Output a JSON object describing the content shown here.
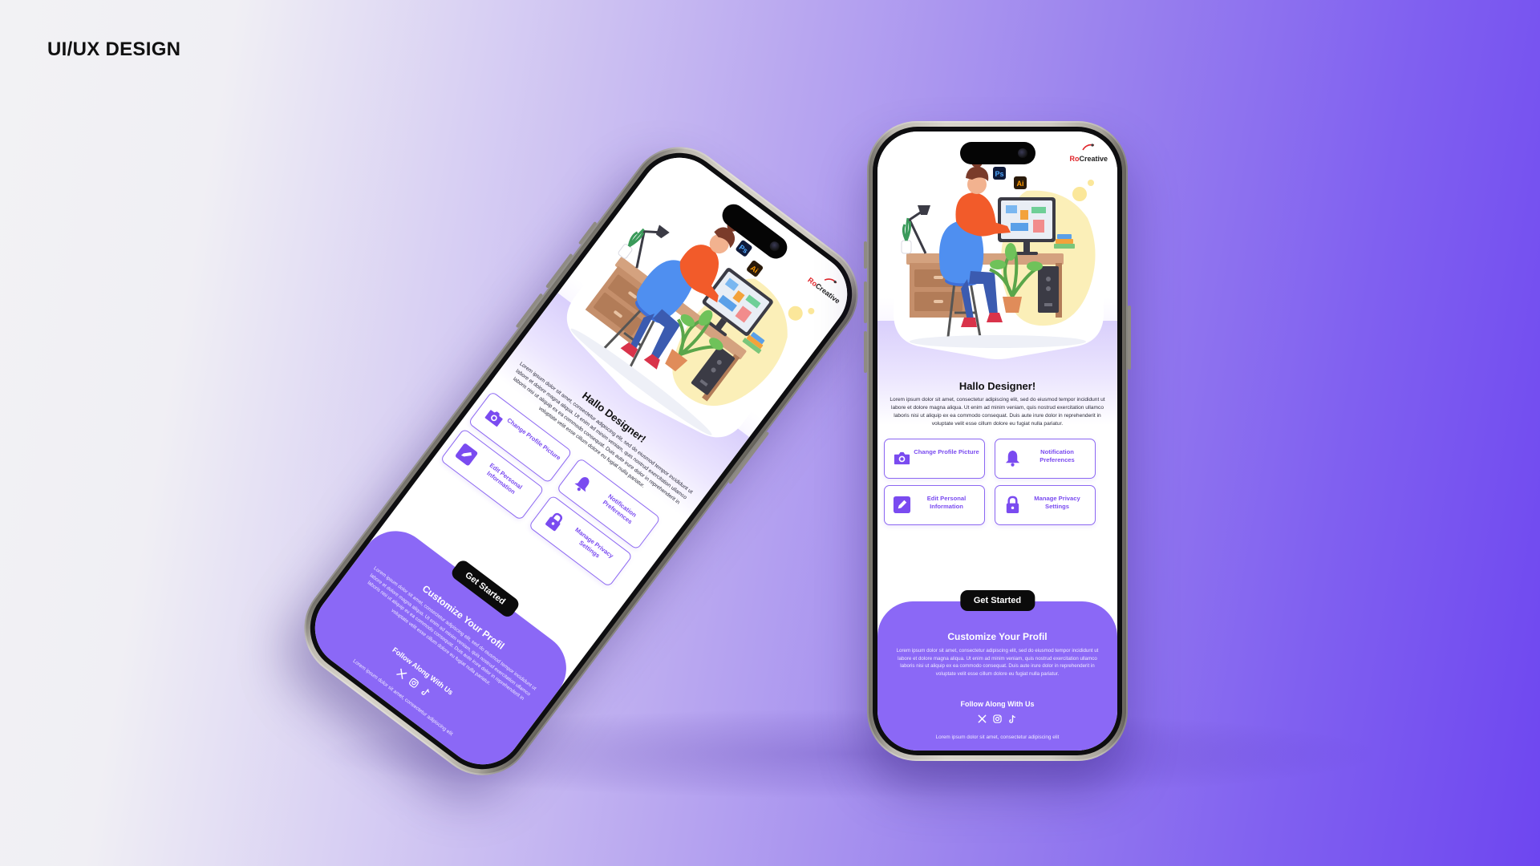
{
  "page": {
    "title": "UI/UX DESIGN"
  },
  "app": {
    "logo": {
      "prefix": "Ro",
      "suffix": "Creative"
    },
    "hero": {
      "software_badges": [
        "Ps",
        "Ai"
      ]
    },
    "greeting": "Hallo Designer!",
    "intro": "Lorem ipsum dolor sit amet, consectetur adipiscing elit, sed do eiusmod tempor incididunt ut labore et dolore magna aliqua. Ut enim ad minim veniam, quis nostrud exercitation ullamco laboris nisi ut aliquip ex ea commodo consequat. Duis aute irure dolor in reprehenderit in voluptate velit esse cillum dolore eu fugiat nulla pariatur.",
    "cards": [
      {
        "label": "Change Profile Picture",
        "icon": "camera-icon"
      },
      {
        "label": "Notification Preferences",
        "icon": "bell-icon"
      },
      {
        "label": "Edit Personal Information",
        "icon": "pencil-icon"
      },
      {
        "label": "Manage Privacy Settings",
        "icon": "lock-icon"
      }
    ],
    "cta_label": "Get Started",
    "footer": {
      "title": "Customize Your Profil",
      "text": "Lorem ipsum dolor sit amet, consectetur adipiscing elit, sed do eiusmod tempor incididunt ut labore et dolore magna aliqua. Ut enim ad minim veniam, quis nostrud exercitation ullamco laboris nisi ut aliquip ex ea commodo consequat. Duis aute irure dolor in reprehenderit in voluptate velit esse cillum dolore eu fugiat nulla pariatur.",
      "follow_label": "Follow Along With Us",
      "socials": [
        "x-icon",
        "instagram-icon",
        "tiktok-icon"
      ],
      "copyright": "Lorem ipsum dolor sit amet, consectetur adipiscing elit"
    }
  },
  "colors": {
    "accent": "#8b68f6",
    "accent_dark": "#7a4bf0",
    "button": "#0b0b0b"
  }
}
